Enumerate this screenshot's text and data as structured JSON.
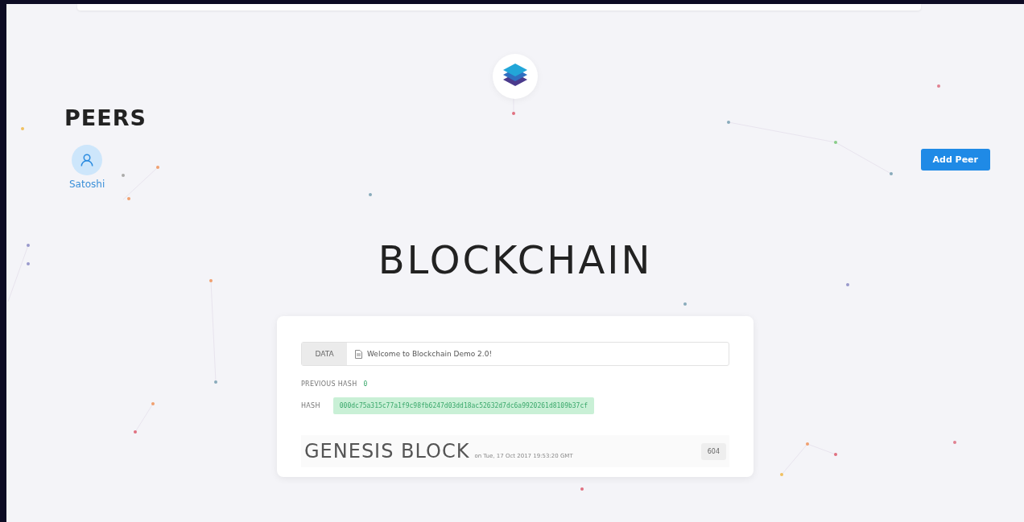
{
  "peers": {
    "title": "PEERS",
    "items": [
      {
        "name": "Satoshi",
        "selected": true
      }
    ]
  },
  "add_peer_button": "Add Peer",
  "title": "BLOCKCHAIN",
  "block": {
    "data_label": "DATA",
    "data_value": "Welcome to Blockchain Demo 2.0!",
    "previous_hash_label": "PREVIOUS HASH",
    "previous_hash": "0",
    "hash_label": "HASH",
    "hash": "000dc75a315c77a1f9c98fb6247d03dd18ac52632d7dc6a9920261d8109b37cf",
    "valid": true,
    "name": "GENESIS BLOCK",
    "timestamp": "on Tue, 17 Oct 2017 19:53:20 GMT",
    "nonce": "604"
  }
}
